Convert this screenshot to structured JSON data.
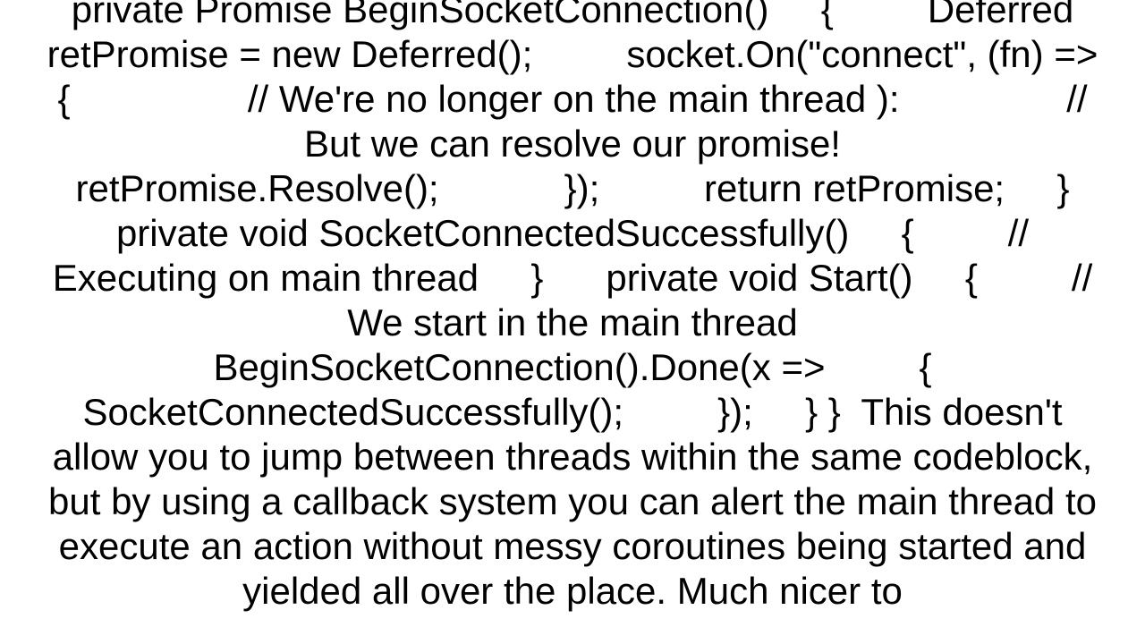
{
  "document": {
    "body": "private Promise BeginSocketConnection()     {         Deferred retPromise = new Deferred();         socket.On(\"connect\", (fn) =>            {                 // We're no longer on the main thread ):                // But we can resolve our promise!                retPromise.Resolve();            });          return retPromise;     }      private void SocketConnectedSuccessfully()     {         // Executing on main thread     }      private void Start()     {         // We start in the main thread         BeginSocketConnection().Done(x =>         {             SocketConnectedSuccessfully();         });     } }  This doesn't allow you to jump between threads within the same codeblock, but by using a callback system you can alert the main thread to execute an action without messy coroutines being started and yielded all over the place. Much nicer to"
  }
}
